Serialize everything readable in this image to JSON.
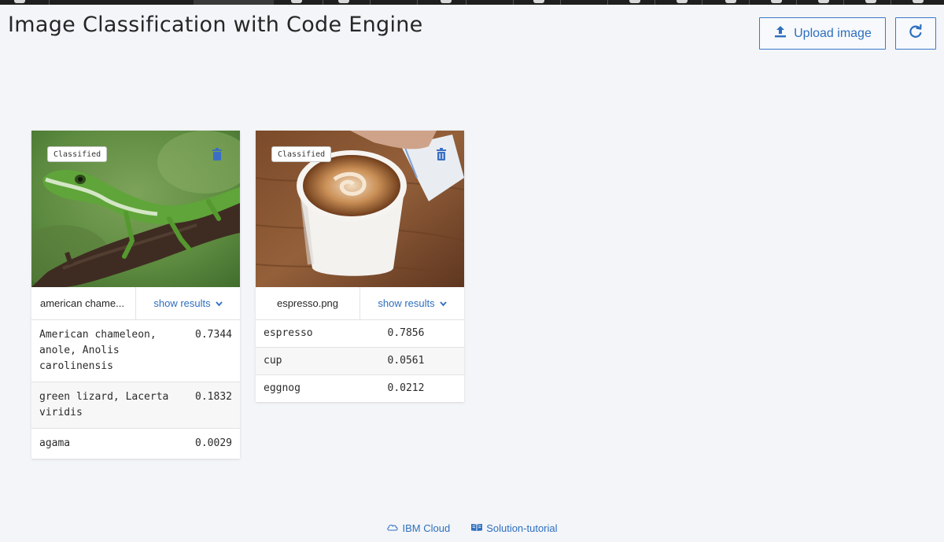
{
  "header": {
    "title": "Image Classification with Code Engine",
    "upload_label": "Upload image",
    "upload_icon": "upload-icon",
    "refresh_icon": "refresh-icon"
  },
  "cards": [
    {
      "badge": "Classified",
      "filename": "american chame...",
      "toggle_label": "show results",
      "results": [
        {
          "label": "American chameleon, anole, Anolis carolinensis",
          "score": "0.7344"
        },
        {
          "label": "green lizard, Lacerta viridis",
          "score": "0.1832"
        },
        {
          "label": "agama",
          "score": "0.0029"
        }
      ]
    },
    {
      "badge": "Classified",
      "filename": "espresso.png",
      "toggle_label": "show results",
      "results": [
        {
          "label": "espresso",
          "score": "0.7856"
        },
        {
          "label": "cup",
          "score": "0.0561"
        },
        {
          "label": "eggnog",
          "score": "0.0212"
        }
      ]
    }
  ],
  "footer": {
    "links": [
      {
        "label": "IBM Cloud",
        "icon": "cloud-icon"
      },
      {
        "label": "Solution-tutorial",
        "icon": "book-icon"
      }
    ]
  },
  "colors": {
    "accent": "#2e6fbf",
    "background": "#f3f5f8"
  }
}
